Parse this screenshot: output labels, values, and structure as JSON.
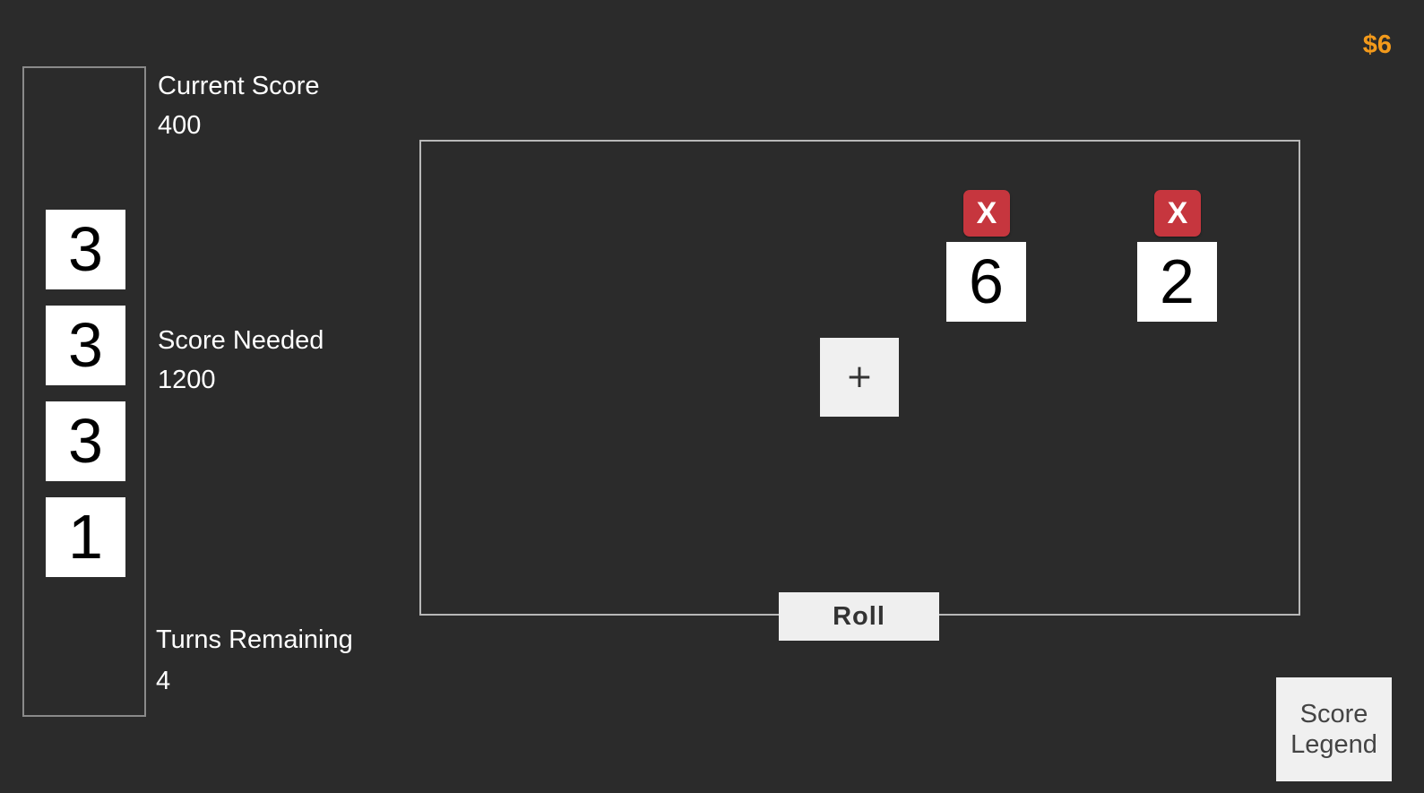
{
  "money": "$6",
  "held_dice": [
    "3",
    "3",
    "3",
    "1"
  ],
  "stats": {
    "current_score_label": "Current Score",
    "current_score_value": "400",
    "score_needed_label": "Score Needed",
    "score_needed_value": "1200",
    "turns_remaining_label": "Turns Remaining",
    "turns_remaining_value": "4"
  },
  "rolled_dice": [
    {
      "value": "6",
      "discard_label": "X"
    },
    {
      "value": "2",
      "discard_label": "X"
    }
  ],
  "add_button_label": "+",
  "roll_button_label": "Roll",
  "score_legend_label": "Score\nLegend",
  "colors": {
    "background": "#2b2b2b",
    "money": "#f39a1b",
    "discard": "#c6363e",
    "die_face": "#ffffff"
  }
}
